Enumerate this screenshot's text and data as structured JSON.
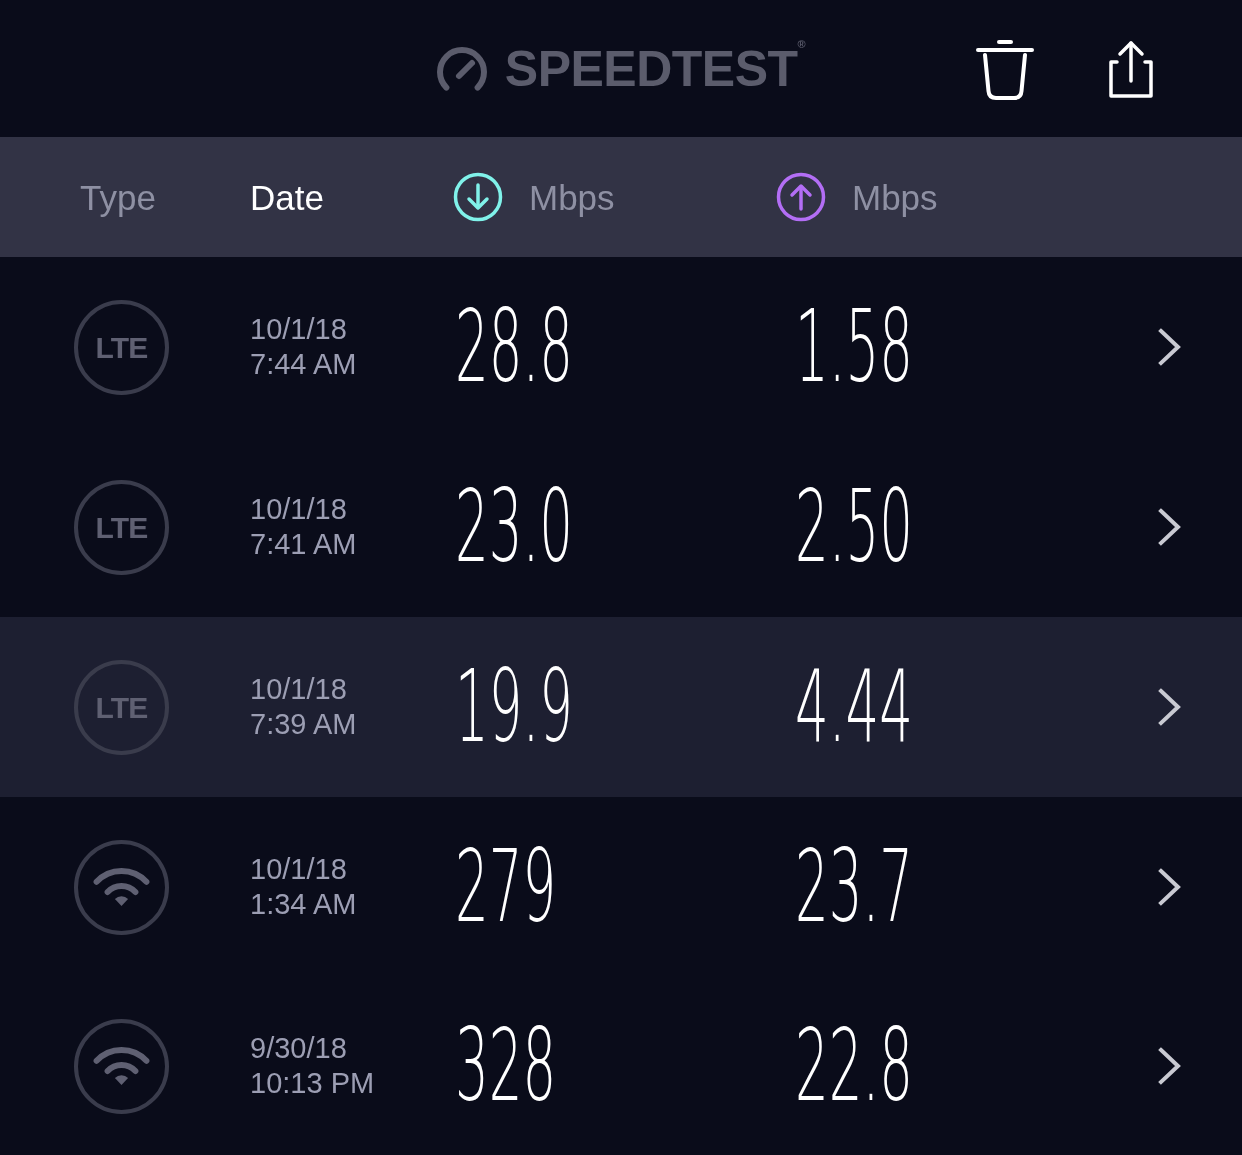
{
  "header": {
    "logo": "SPEEDTEST$^{®}$"
  },
  "columns": [
    {
      "kind": "type",
      "label": "Type",
      "selected": false
    },
    {
      "kind": "date",
      "label": "Date",
      "selected": true
    },
    {
      "kind": "download",
      "label": "Mbps",
      "selected": false
    },
    {
      "kind": "upload",
      "label": "Mbps",
      "selected": false
    }
  ],
  "rows": [
    {
      "connection": {
        "kind": "lte",
        "label": "LTE"
      },
      "date": "10/1/18",
      "time": "7:44 AM",
      "download": "28.8",
      "upload": "1.58",
      "selected": false
    },
    {
      "connection": {
        "kind": "lte",
        "label": "LTE"
      },
      "date": "10/1/18",
      "time": "7:41 AM",
      "download": "23.0",
      "upload": "2.50",
      "selected": false
    },
    {
      "connection": {
        "kind": "lte",
        "label": "LTE"
      },
      "date": "10/1/18",
      "time": "7:39 AM",
      "download": "19.9",
      "upload": "4.44",
      "selected": true
    },
    {
      "connection": {
        "kind": "wifi"
      },
      "date": "10/1/18",
      "time": "1:34 AM",
      "download": "279",
      "upload": "23.7",
      "selected": false
    },
    {
      "connection": {
        "kind": "wifi"
      },
      "date": "9/30/18",
      "time": "10:13 PM",
      "download": "328",
      "upload": "22.8",
      "selected": false
    }
  ]
}
